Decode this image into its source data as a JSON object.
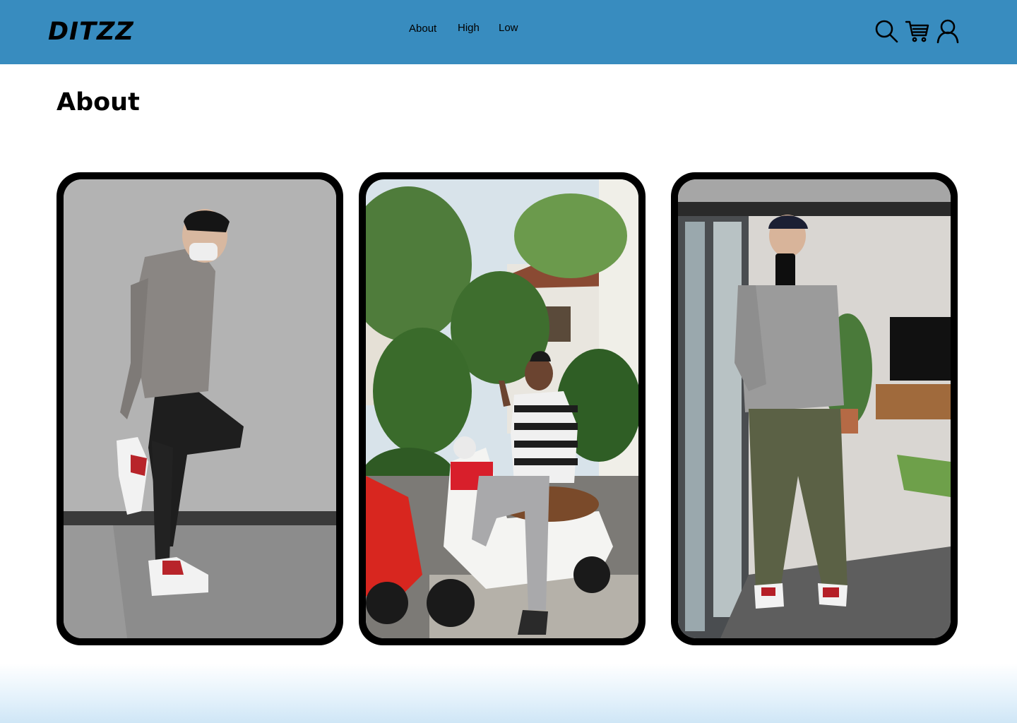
{
  "header": {
    "logo": "DITZZ",
    "nav": [
      {
        "label": "About"
      },
      {
        "label": "High"
      },
      {
        "label": "Low"
      }
    ],
    "icons": [
      "search-icon",
      "cart-icon",
      "user-icon"
    ]
  },
  "main": {
    "title": "About",
    "photos": [
      {
        "subject": "person-in-grey-hoodie-with-sneakers"
      },
      {
        "subject": "person-on-white-scooter-among-palms"
      },
      {
        "subject": "person-taking-mirror-selfie"
      }
    ]
  },
  "colors": {
    "header_bg": "#388cbf",
    "card_frame": "#000000",
    "footer_gradient_end": "#cfe6f6"
  }
}
